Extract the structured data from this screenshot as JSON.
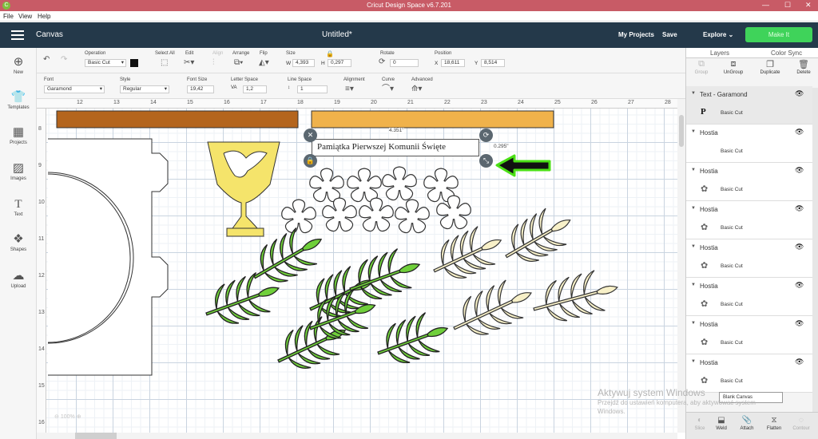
{
  "window": {
    "title": "Cricut Design Space  v6.7.201",
    "logo": "cricut-logo",
    "controls": [
      "—",
      "☐",
      "✕"
    ]
  },
  "menu": [
    "File",
    "View",
    "Help"
  ],
  "header": {
    "canvas": "Canvas",
    "doc_title": "Untitled*",
    "my_projects": "My Projects",
    "save": "Save",
    "explore": "Explore",
    "make": "Make It"
  },
  "toolbar1": {
    "operation": {
      "label": "Operation",
      "value": "Basic Cut"
    },
    "select_all": "Select All",
    "edit": "Edit",
    "align": "Align",
    "arrange": "Arrange",
    "flip": "Flip",
    "size": {
      "label": "Size",
      "w_label": "W",
      "w": "4,393",
      "h_label": "H",
      "h": "0,297"
    },
    "rotate": {
      "label": "Rotate",
      "value": "0"
    },
    "position": {
      "label": "Position",
      "x_label": "X",
      "x": "18,611",
      "y_label": "Y",
      "y": "8,514"
    }
  },
  "toolbar2": {
    "font": {
      "label": "Font",
      "value": "Garamond"
    },
    "style": {
      "label": "Style",
      "value": "Regular"
    },
    "font_size": {
      "label": "Font Size",
      "value": "19,42"
    },
    "letter_space": {
      "label": "Letter Space",
      "value": "1,2"
    },
    "line_space": {
      "label": "Line Space",
      "value": "1"
    },
    "alignment": "Alignment",
    "curve": "Curve",
    "advanced": "Advanced"
  },
  "sidebar": [
    {
      "label": "New",
      "icon": "plus-icon"
    },
    {
      "label": "Templates",
      "icon": "shirt-icon"
    },
    {
      "label": "Projects",
      "icon": "folder-icon"
    },
    {
      "label": "Images",
      "icon": "image-icon"
    },
    {
      "label": "Text",
      "icon": "text-icon"
    },
    {
      "label": "Shapes",
      "icon": "shapes-icon"
    },
    {
      "label": "Upload",
      "icon": "upload-icon"
    }
  ],
  "ruler_top": [
    "12",
    "13",
    "14",
    "15",
    "16",
    "17",
    "18",
    "19",
    "20",
    "21",
    "22",
    "23",
    "24",
    "25",
    "26",
    "27",
    "28"
  ],
  "ruler_left": [
    "8",
    "9",
    "10",
    "11",
    "12",
    "13",
    "14",
    "15",
    "16"
  ],
  "canvas": {
    "selected_text": "Pamiątka Pierwszej Komunii Święte",
    "width_label": "4.351\"",
    "height_label": "0.295\"",
    "zoom": "100%"
  },
  "panel": {
    "tabs": [
      "Layers",
      "Color Sync"
    ],
    "buttons": [
      "Group",
      "UnGroup",
      "Duplicate",
      "Delete"
    ],
    "layers": [
      {
        "name": "Text - Garamond",
        "sub": "Basic Cut",
        "thumb": "P"
      },
      {
        "name": "Hostia",
        "sub": "Basic Cut",
        "thumb": ""
      },
      {
        "name": "Hostia",
        "sub": "Basic Cut",
        "thumb": "✿"
      },
      {
        "name": "Hostia",
        "sub": "Basic Cut",
        "thumb": "✿"
      },
      {
        "name": "Hostia",
        "sub": "Basic Cut",
        "thumb": "✿"
      },
      {
        "name": "Hostia",
        "sub": "Basic Cut",
        "thumb": "✿"
      },
      {
        "name": "Hostia",
        "sub": "Basic Cut",
        "thumb": "✿"
      },
      {
        "name": "Hostia",
        "sub": "Basic Cut",
        "thumb": "✿"
      }
    ],
    "blank_canvas": "Blank Canvas",
    "footer": [
      "Slice",
      "Weld",
      "Attach",
      "Flatten",
      "Contour"
    ]
  },
  "watermark": {
    "title": "Aktywuj system Windows",
    "line1": "Przejdź do ustawień komputera, aby aktywować system",
    "line2": "Windows."
  }
}
